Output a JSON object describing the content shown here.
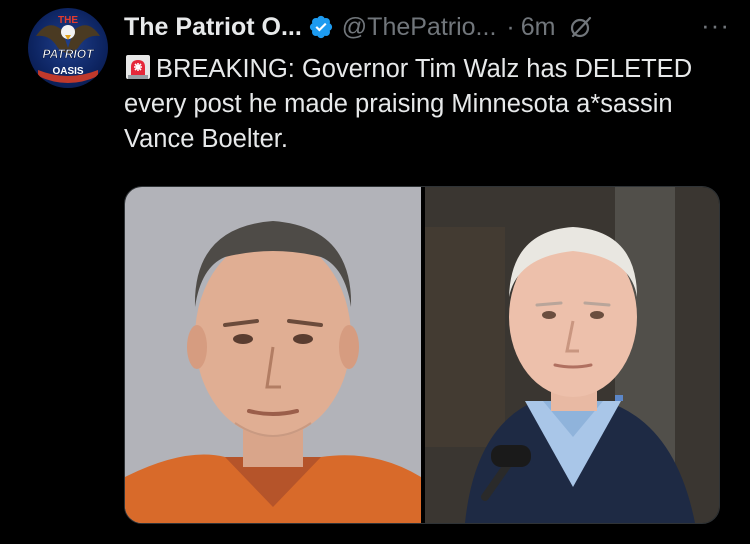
{
  "author": {
    "display_name": "The Patriot O...",
    "handle": "@ThePatrio...",
    "separator": "·",
    "time": "6m",
    "avatar_text_top": "THE",
    "avatar_text_mid": "PATRIOT",
    "avatar_text_bottom": "OASIS",
    "verified_color": "#1d9bf0"
  },
  "tweet": {
    "text": "BREAKING: Governor Tim Walz has DELETED every post he made praising Minnesota a*sassin Vance Boelter.",
    "emoji": "police-light-emoji"
  },
  "menu": {
    "more_label": "···"
  },
  "media": {
    "left_photo": "mugshot-photo",
    "right_photo": "governor-photo"
  }
}
